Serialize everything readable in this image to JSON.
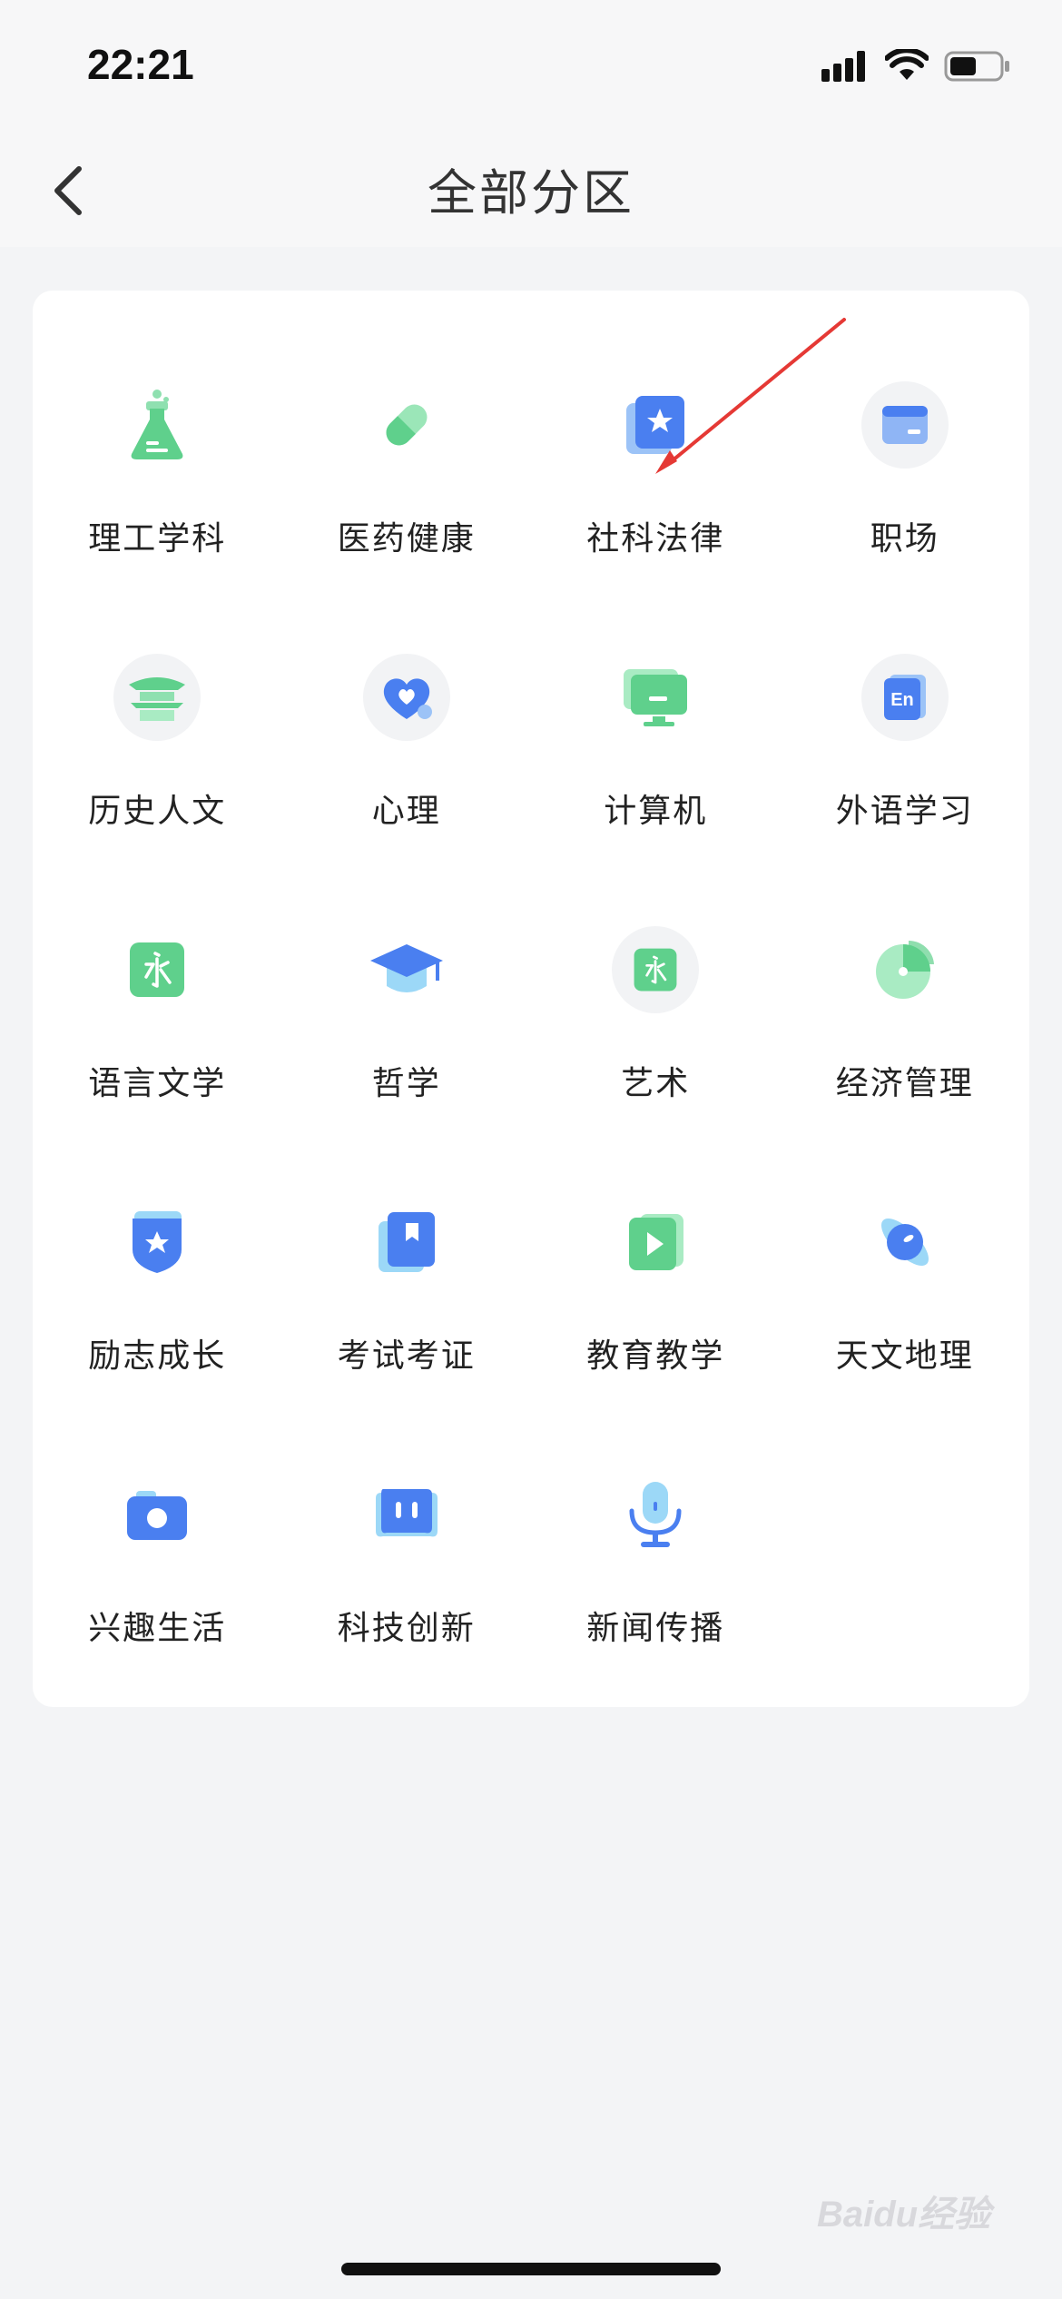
{
  "status_bar": {
    "time": "22:21"
  },
  "header": {
    "title": "全部分区"
  },
  "categories": [
    {
      "label": "理工学科",
      "icon": "flask-icon"
    },
    {
      "label": "医药健康",
      "icon": "pill-icon"
    },
    {
      "label": "社科法律",
      "icon": "star-card-icon"
    },
    {
      "label": "职场",
      "icon": "card-icon"
    },
    {
      "label": "历史人文",
      "icon": "pavilion-icon"
    },
    {
      "label": "心理",
      "icon": "heart-icon"
    },
    {
      "label": "计算机",
      "icon": "monitor-icon"
    },
    {
      "label": "外语学习",
      "icon": "en-book-icon"
    },
    {
      "label": "语言文学",
      "icon": "yong-character-icon"
    },
    {
      "label": "哲学",
      "icon": "graduation-cap-icon"
    },
    {
      "label": "艺术",
      "icon": "yong-character-icon"
    },
    {
      "label": "经济管理",
      "icon": "pie-chart-icon"
    },
    {
      "label": "励志成长",
      "icon": "shield-star-icon"
    },
    {
      "label": "考试考证",
      "icon": "bookmark-book-icon"
    },
    {
      "label": "教育教学",
      "icon": "play-icon"
    },
    {
      "label": "天文地理",
      "icon": "planet-icon"
    },
    {
      "label": "兴趣生活",
      "icon": "camera-icon"
    },
    {
      "label": "科技创新",
      "icon": "robot-icon"
    },
    {
      "label": "新闻传播",
      "icon": "microphone-icon"
    }
  ],
  "watermark": {
    "text": "Baidu经验"
  },
  "colors": {
    "green": "#5fd08c",
    "blue": "#4a7ff0",
    "annotation_red": "#e53935"
  }
}
